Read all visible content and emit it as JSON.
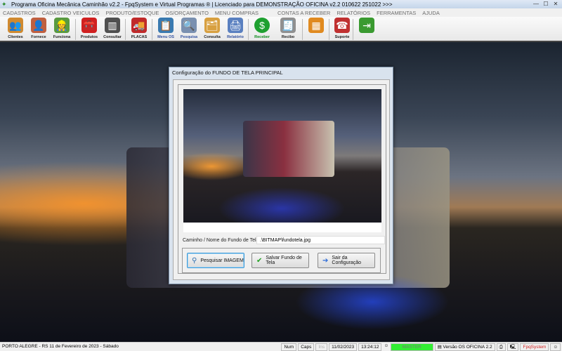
{
  "window": {
    "title": "Programa Oficina Mecânica Caminhão v2.2 - FpqSystem e Virtual Programas ® | Licenciado para  DEMONSTRAÇÃO OFICINA v2.2 010622 251022 >>>"
  },
  "menu": [
    "CADASTROS",
    "CADASTRO VEICULOS",
    "PRODUTO/ESTOQUE",
    "OS/ORÇAMENTO",
    "MENU COMPRAS",
    "CONTAS A RECEBER",
    "RELATÓRIOS",
    "FERRAMENTAS",
    "AJUDA"
  ],
  "toolbar": [
    {
      "label": "Clientes",
      "icon": "users-icon",
      "color": "#d08a30"
    },
    {
      "label": "Fornece",
      "icon": "person-icon",
      "color": "#c06040"
    },
    {
      "label": "Funciona",
      "icon": "worker-icon",
      "color": "#5a9a40"
    },
    {
      "label": "Produtos",
      "icon": "toolbox-icon",
      "color": "#d02020"
    },
    {
      "label": "Consultar",
      "icon": "barcode-icon",
      "color": "#505050"
    },
    {
      "label": "PLACAS",
      "icon": "truck-icon",
      "color": "#c02a2a"
    },
    {
      "label": "Menu OS",
      "icon": "clipboard-icon",
      "color": "#3a7ab0"
    },
    {
      "label": "Pesquisa",
      "icon": "document-search-icon",
      "color": "#7a90b0"
    },
    {
      "label": "Consulta",
      "icon": "folder-icon",
      "color": "#d8a040"
    },
    {
      "label": "Relatório",
      "icon": "printer-icon",
      "color": "#5a80c0"
    },
    {
      "label": "Receber",
      "icon": "dollar-icon",
      "color": "#1ea030"
    },
    {
      "label": "Recibo",
      "icon": "receipt-icon",
      "color": "#909090"
    },
    {
      "label": "",
      "icon": "calculator-icon",
      "color": "#e08a20"
    },
    {
      "label": "Suporte",
      "icon": "support-icon",
      "color": "#c03030"
    },
    {
      "label": "",
      "icon": "exit-icon",
      "color": "#3a9a30"
    }
  ],
  "dialog": {
    "title": "Configuração do FUNDO DE TELA PRINCIPAL",
    "path_label": "Caminho / Nome do Fundo de Tela",
    "path_value": ".\\BITMAP\\fundotela.jpg",
    "buttons": {
      "search": "Pesquisar IMAGEM",
      "save": "Salvar Fundo de Tela",
      "exit": "Sair da Configuração"
    }
  },
  "status": {
    "location": "PORTO ALEGRE - RS 11 de Fevereiro de 2023 - Sábado",
    "num": "Num",
    "caps": "Caps",
    "ins": "Ins",
    "date": "11/02/2023",
    "time": "13:24:12",
    "user": "MASTER",
    "user_color": "#33ee33",
    "version": "Versão OS OFICINA 2.2",
    "brand": "FpqSystem",
    "brand_color": "#d02020"
  }
}
